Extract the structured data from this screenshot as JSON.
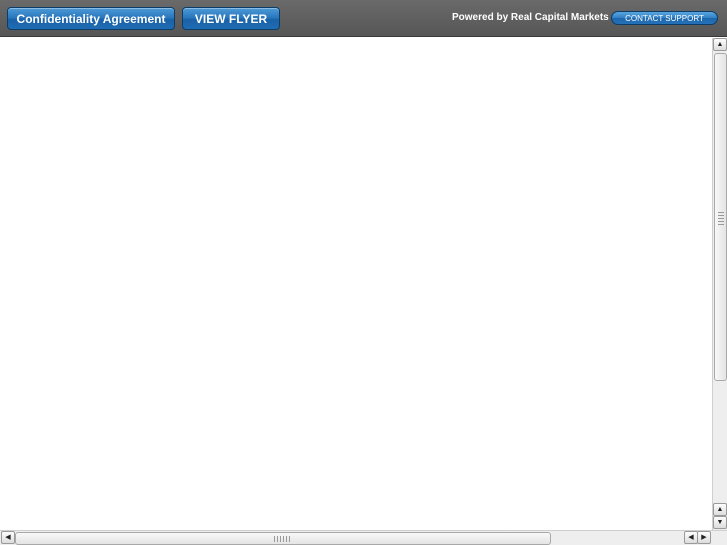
{
  "toolbar": {
    "confidentiality_label": "Confidentiality Agreement",
    "view_flyer_label": "VIEW FLYER",
    "powered_by": "Powered by Real Capital Markets",
    "contact_support_label": "CONTACT SUPPORT"
  },
  "icons": {
    "scroll_up": "up-arrow-icon",
    "scroll_down": "down-arrow-icon",
    "scroll_left": "left-arrow-icon",
    "scroll_right": "right-arrow-icon"
  },
  "colors": {
    "toolbar_bg": "#5f5f5f",
    "button_blue": "#2a78be",
    "content_bg": "#ffffff"
  }
}
